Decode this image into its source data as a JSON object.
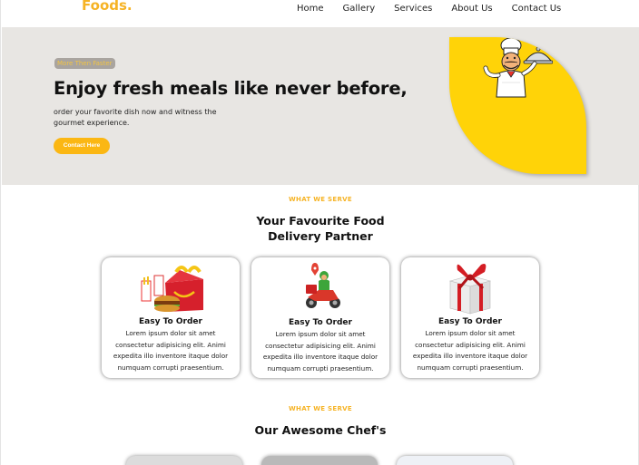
{
  "nav": {
    "logo": "Foods.",
    "links": [
      "Home",
      "Gallery",
      "Services",
      "About Us",
      "Contact Us"
    ]
  },
  "hero": {
    "badge": "More Then Faster",
    "title": "Enjoy fresh meals like never before,",
    "description": "order your favorite dish now and witness the gourmet experience.",
    "button": "Contact Here"
  },
  "services": {
    "label": "WHAT WE SERVE",
    "title_line1": "Your Favourite Food",
    "title_line2": "Delivery Partner",
    "cards": [
      {
        "title": "Easy To Order",
        "icon": "happy-meal-icon",
        "text": "Lorem ipsum dolor sit amet consectetur adipisicing elit. Animi expedita illo inventore itaque dolor numquam corrupti praesentium."
      },
      {
        "title": "Easy To Order",
        "icon": "delivery-scooter-icon",
        "text": "Lorem ipsum dolor sit amet consectetur adipisicing elit. Animi expedita illo inventore itaque dolor numquam corrupti praesentium."
      },
      {
        "title": "Easy To Order",
        "icon": "gift-box-icon",
        "text": "Lorem ipsum dolor sit amet consectetur adipisicing elit. Animi expedita illo inventore itaque dolor numquam corrupti praesentium."
      }
    ]
  },
  "chefs": {
    "label": "WHAT WE SERVE",
    "title": "Our Awesome Chef's"
  },
  "colors": {
    "accent": "#f6b324",
    "hero_bg": "#e8e6e3",
    "blob": "#ffd308"
  }
}
